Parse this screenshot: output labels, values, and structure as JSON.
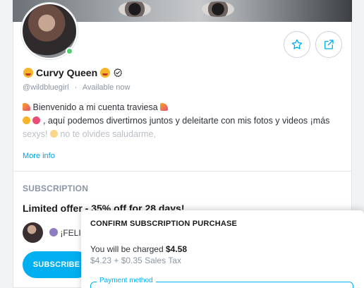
{
  "profile": {
    "name": "Curvy Queen",
    "handle": "@wildbluegirl",
    "separator": "·",
    "availability": "Available now",
    "bio_line1": "Bienvenido a mi cuenta traviesa",
    "bio_line2": ", aquí podemos divertirnos juntos y deleitarte con mis fotos y videos ¡más",
    "bio_line3": "sexys!",
    "bio_line3b": "no te olvides saludarme,",
    "more_info": "More info",
    "online": true
  },
  "actions": {
    "favorite_icon": "star-icon",
    "share_icon": "share-icon"
  },
  "subscription": {
    "section_label": "SUBSCRIPTION",
    "offer_title": "Limited offer - 35% off for 28 days!",
    "promo_text": "¡FELIZ",
    "subscribe_label": "SUBSCRIBE"
  },
  "modal": {
    "title": "CONFIRM SUBSCRIPTION PURCHASE",
    "charged_prefix": "You will be charged",
    "charged_amount": "$4.58",
    "tax_breakdown": "$4.23 + $0.35 Sales Tax",
    "payment_method_label": "Payment method"
  },
  "colors": {
    "accent": "#00aff0",
    "online": "#4ed06f",
    "muted_text": "#8a96a3"
  }
}
